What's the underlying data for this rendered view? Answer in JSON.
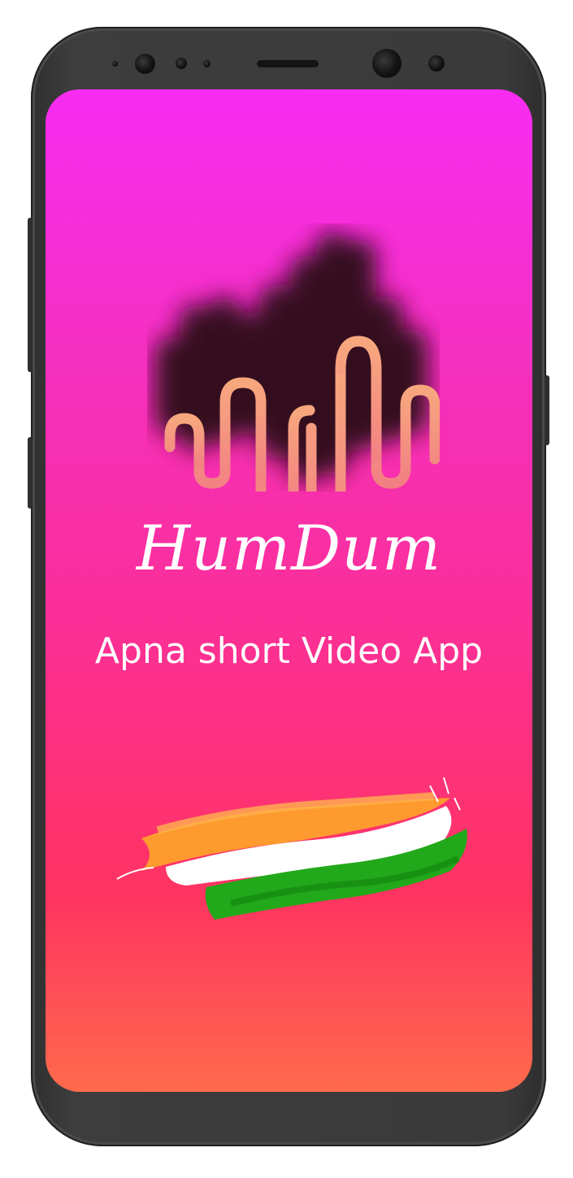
{
  "app": {
    "name": "HumDum",
    "tagline": "Apna short Video App"
  },
  "splash": {
    "logo": "waveform-logo-icon",
    "flag_graphic": "indian-tricolor-brushstroke-icon"
  },
  "colors": {
    "gradient_top": "#f82cf2",
    "gradient_mid": "#fb2f99",
    "gradient_bottom": "#ff6a4c",
    "logo_stroke": "#f59279",
    "logo_shadow": "#3a0c1e",
    "saffron": "#ff9933",
    "green": "#1fa51f",
    "text": "#ffffff",
    "device_frame": "#3a3a3a"
  }
}
